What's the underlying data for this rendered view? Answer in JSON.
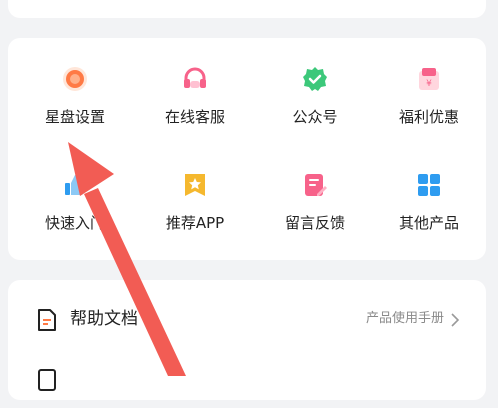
{
  "grid": {
    "items": [
      {
        "label": "星盘设置",
        "icon": "settings-ring-icon"
      },
      {
        "label": "在线客服",
        "icon": "headset-icon"
      },
      {
        "label": "公众号",
        "icon": "verified-badge-icon"
      },
      {
        "label": "福利优惠",
        "icon": "gift-bag-icon"
      },
      {
        "label": "快速入门",
        "icon": "thumbs-up-icon"
      },
      {
        "label": "推荐APP",
        "icon": "star-bookmark-icon"
      },
      {
        "label": "留言反馈",
        "icon": "feedback-pen-icon"
      },
      {
        "label": "其他产品",
        "icon": "app-grid-icon"
      }
    ]
  },
  "list": {
    "help": {
      "label": "帮助文档",
      "hint": "产品使用手册",
      "icon": "document-icon"
    }
  },
  "colors": {
    "accent_orange": "#ff7a45",
    "arrow_red": "#f25c54",
    "green": "#3cc87a",
    "blue": "#2e9cf0",
    "pink": "#f7628a",
    "yellow": "#f5b82e"
  }
}
